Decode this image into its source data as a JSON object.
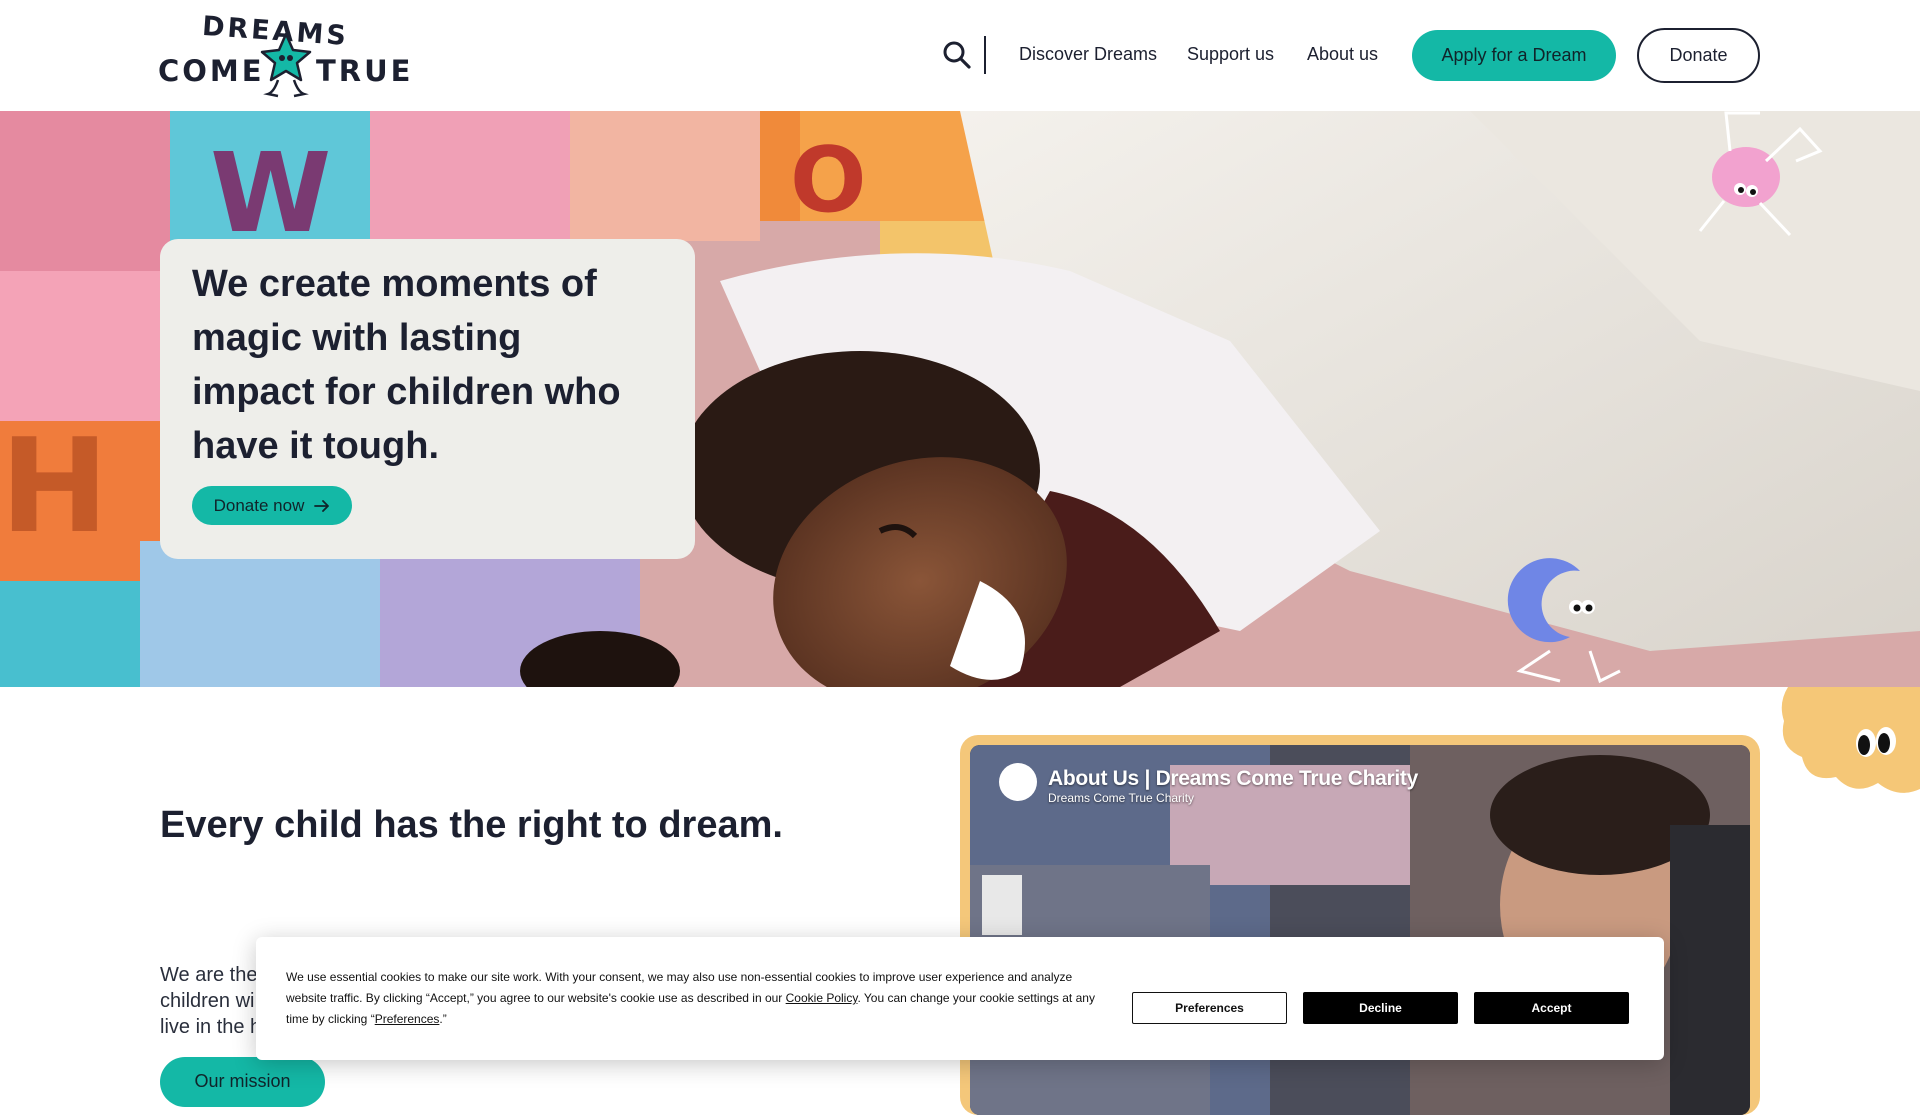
{
  "brand": {
    "logo_line1": "DREAMS",
    "logo_left": "COME",
    "logo_right": "TRUE",
    "accent_color": "#14b8a6",
    "dark_color": "#1c2030"
  },
  "header": {
    "search_icon": "search-icon",
    "nav": [
      {
        "label": "Discover Dreams"
      },
      {
        "label": "Support us"
      },
      {
        "label": "About us"
      }
    ],
    "apply_label": "Apply for a Dream",
    "donate_label": "Donate"
  },
  "hero": {
    "heading": "We create moments of magic with lasting impact for children who have it tough.",
    "cta_label": "Donate now",
    "cta_icon": "arrow-right-icon"
  },
  "mission": {
    "heading": "Every child has the right to dream.",
    "body_lines": [
      "We are the",
      "children wi",
      "live in the h"
    ],
    "cta_label": "Our mission"
  },
  "video": {
    "title": "About Us | Dreams Come True Charity",
    "channel": "Dreams Come True Charity"
  },
  "cookie": {
    "text_before_policy": "We use essential cookies to make our site work. With your consent, we may also use non-essential cookies to improve user experience and analyze website traffic. By clicking “Accept,” you agree to our website's cookie use as described in our ",
    "policy_link": "Cookie Policy",
    "text_after_policy": ". You can change your cookie settings at any time by clicking “",
    "preferences_link": "Preferences",
    "text_end": ".”",
    "preferences_label": "Preferences",
    "decline_label": "Decline",
    "accept_label": "Accept"
  }
}
